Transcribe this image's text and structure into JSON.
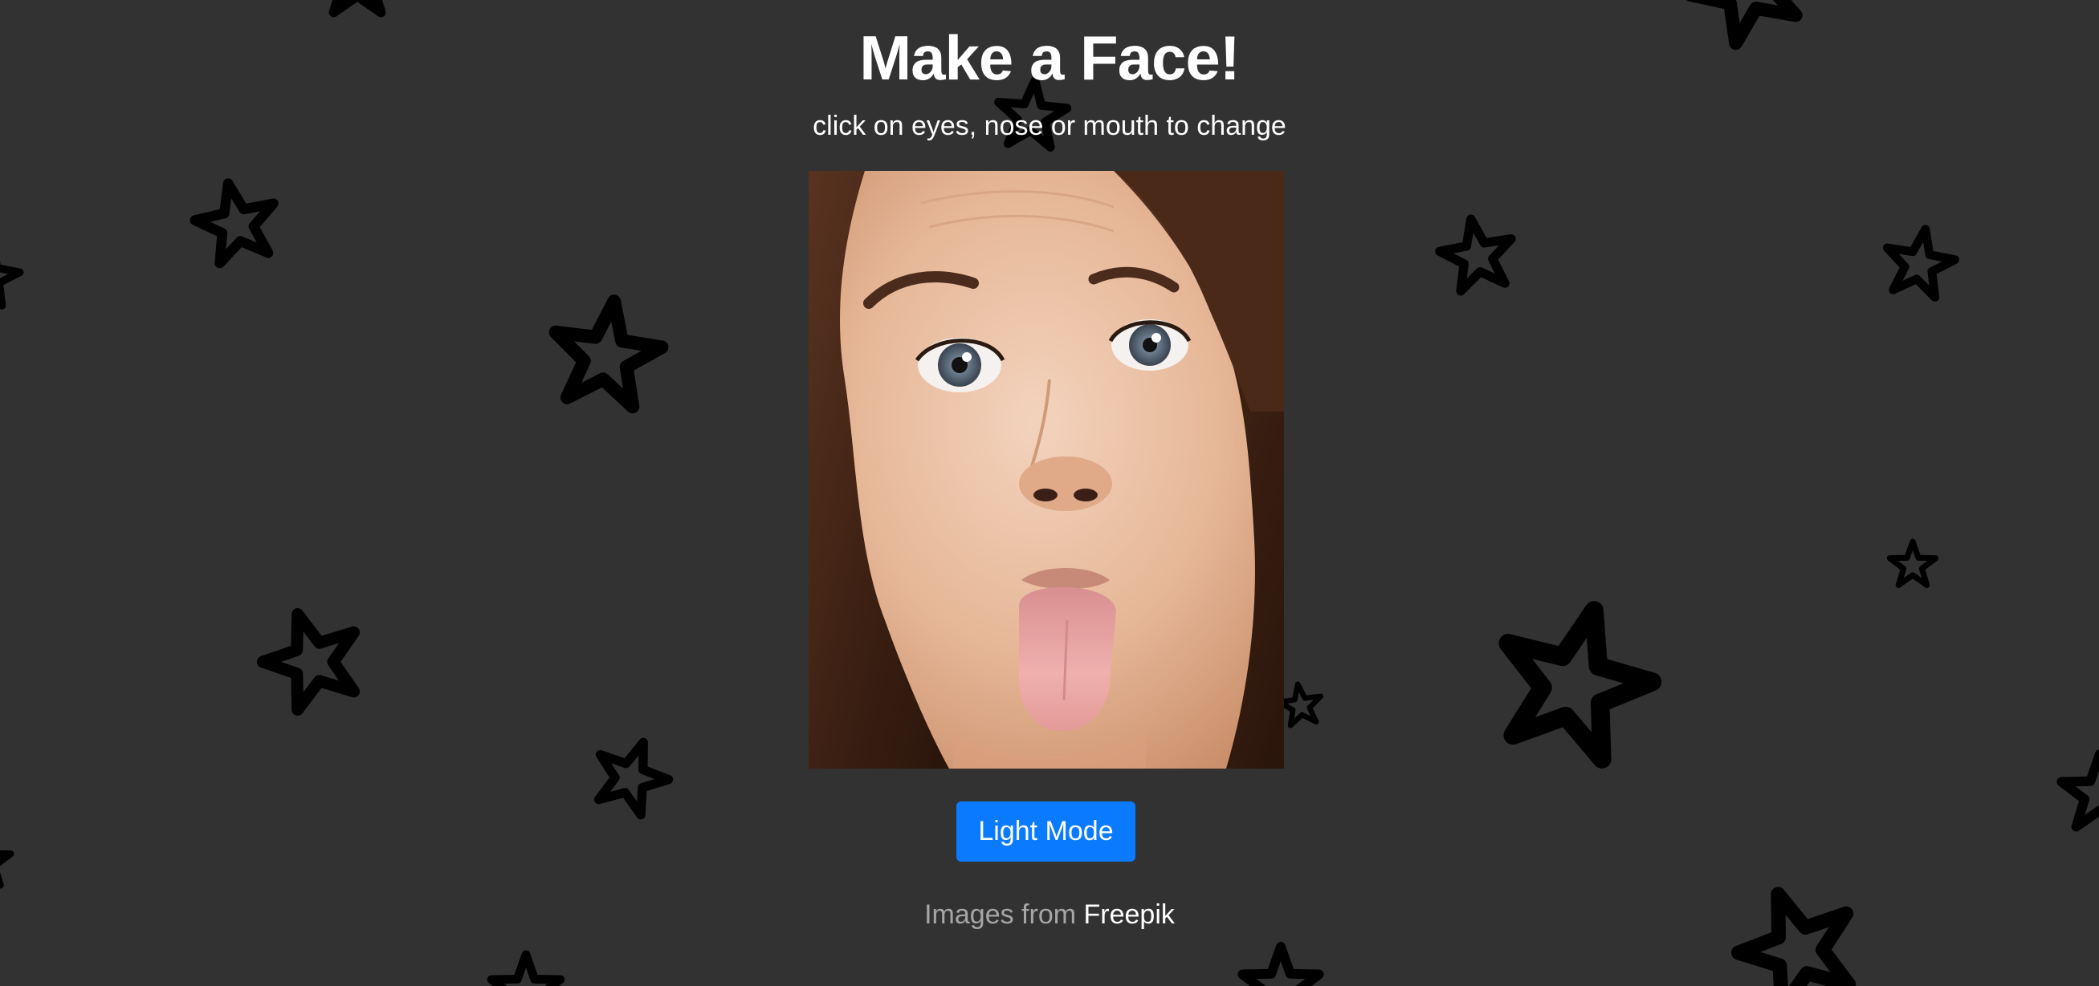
{
  "header": {
    "title": "Make a Face!",
    "subtitle": "click on eyes, nose or mouth to change"
  },
  "face": {
    "parts": [
      "eyes",
      "nose",
      "mouth"
    ]
  },
  "controls": {
    "mode_button_label": "Light Mode"
  },
  "footer": {
    "credit_prefix": "Images from",
    "credit_link": "Freepik"
  },
  "colors": {
    "background": "#323232",
    "button": "#0a7bff",
    "star_outline": "#000000",
    "credit_prefix": "#a6a6a6",
    "text": "#ffffff"
  },
  "icons": {
    "background_pattern": "star-outline-icon"
  }
}
